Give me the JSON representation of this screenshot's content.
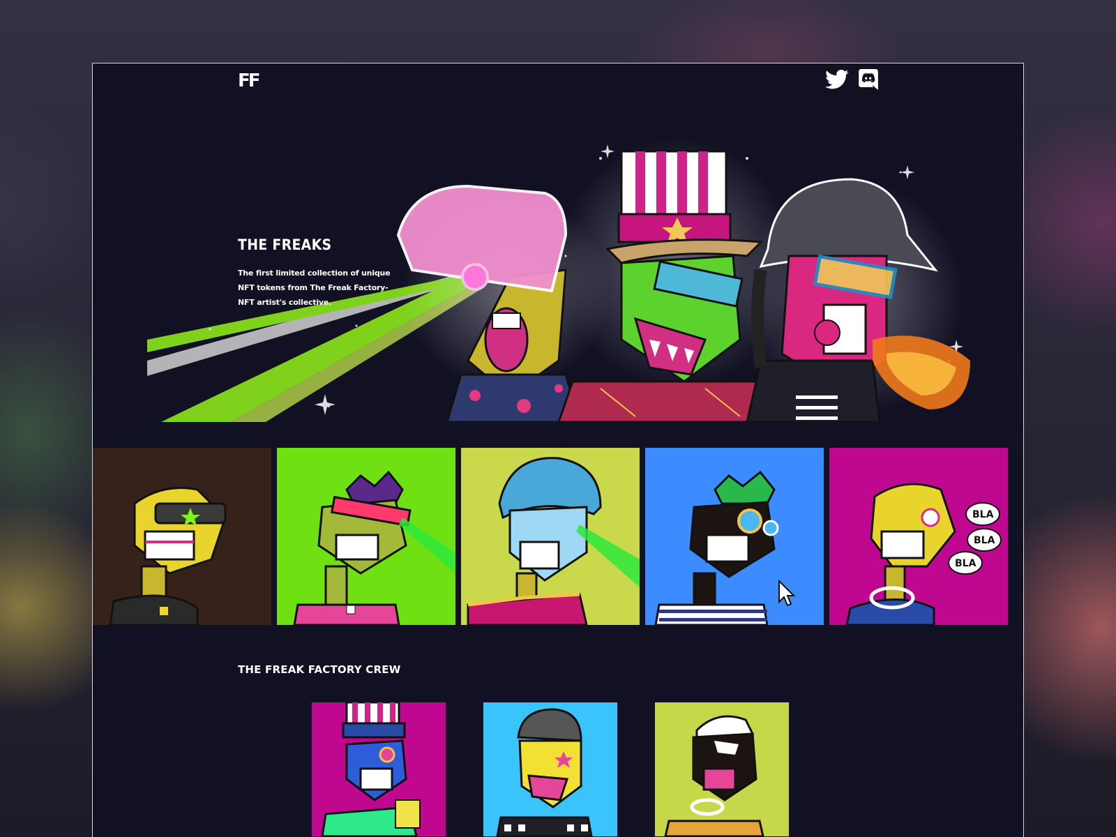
{
  "nav": {
    "logo": "FF",
    "icons": [
      "twitter-icon",
      "discord-icon"
    ]
  },
  "hero": {
    "title": "THE FREAKS",
    "description": "The first limited collection of unique NFT tokens from The Freak Factory- NFT artist's collective."
  },
  "freaks": [
    {
      "name": "freak-tile-1",
      "bg": "#36221b"
    },
    {
      "name": "freak-tile-2",
      "bg": "#6fe012"
    },
    {
      "name": "freak-tile-3",
      "bg": "#c9d94b"
    },
    {
      "name": "freak-tile-4",
      "bg": "#3c8cff"
    },
    {
      "name": "freak-tile-5",
      "bg": "#c0078f"
    }
  ],
  "crew_section": {
    "title": "THE FREAK FACTORY CREW",
    "members": [
      {
        "name": "crew-card-1",
        "bg": "#c0078f"
      },
      {
        "name": "crew-card-2",
        "bg": "#3bc3fb"
      },
      {
        "name": "crew-card-3",
        "bg": "#c6d84a"
      }
    ]
  },
  "colors": {
    "page_bg": "#121124",
    "text": "#ffffff",
    "frame_border": "#d8d8e0"
  }
}
